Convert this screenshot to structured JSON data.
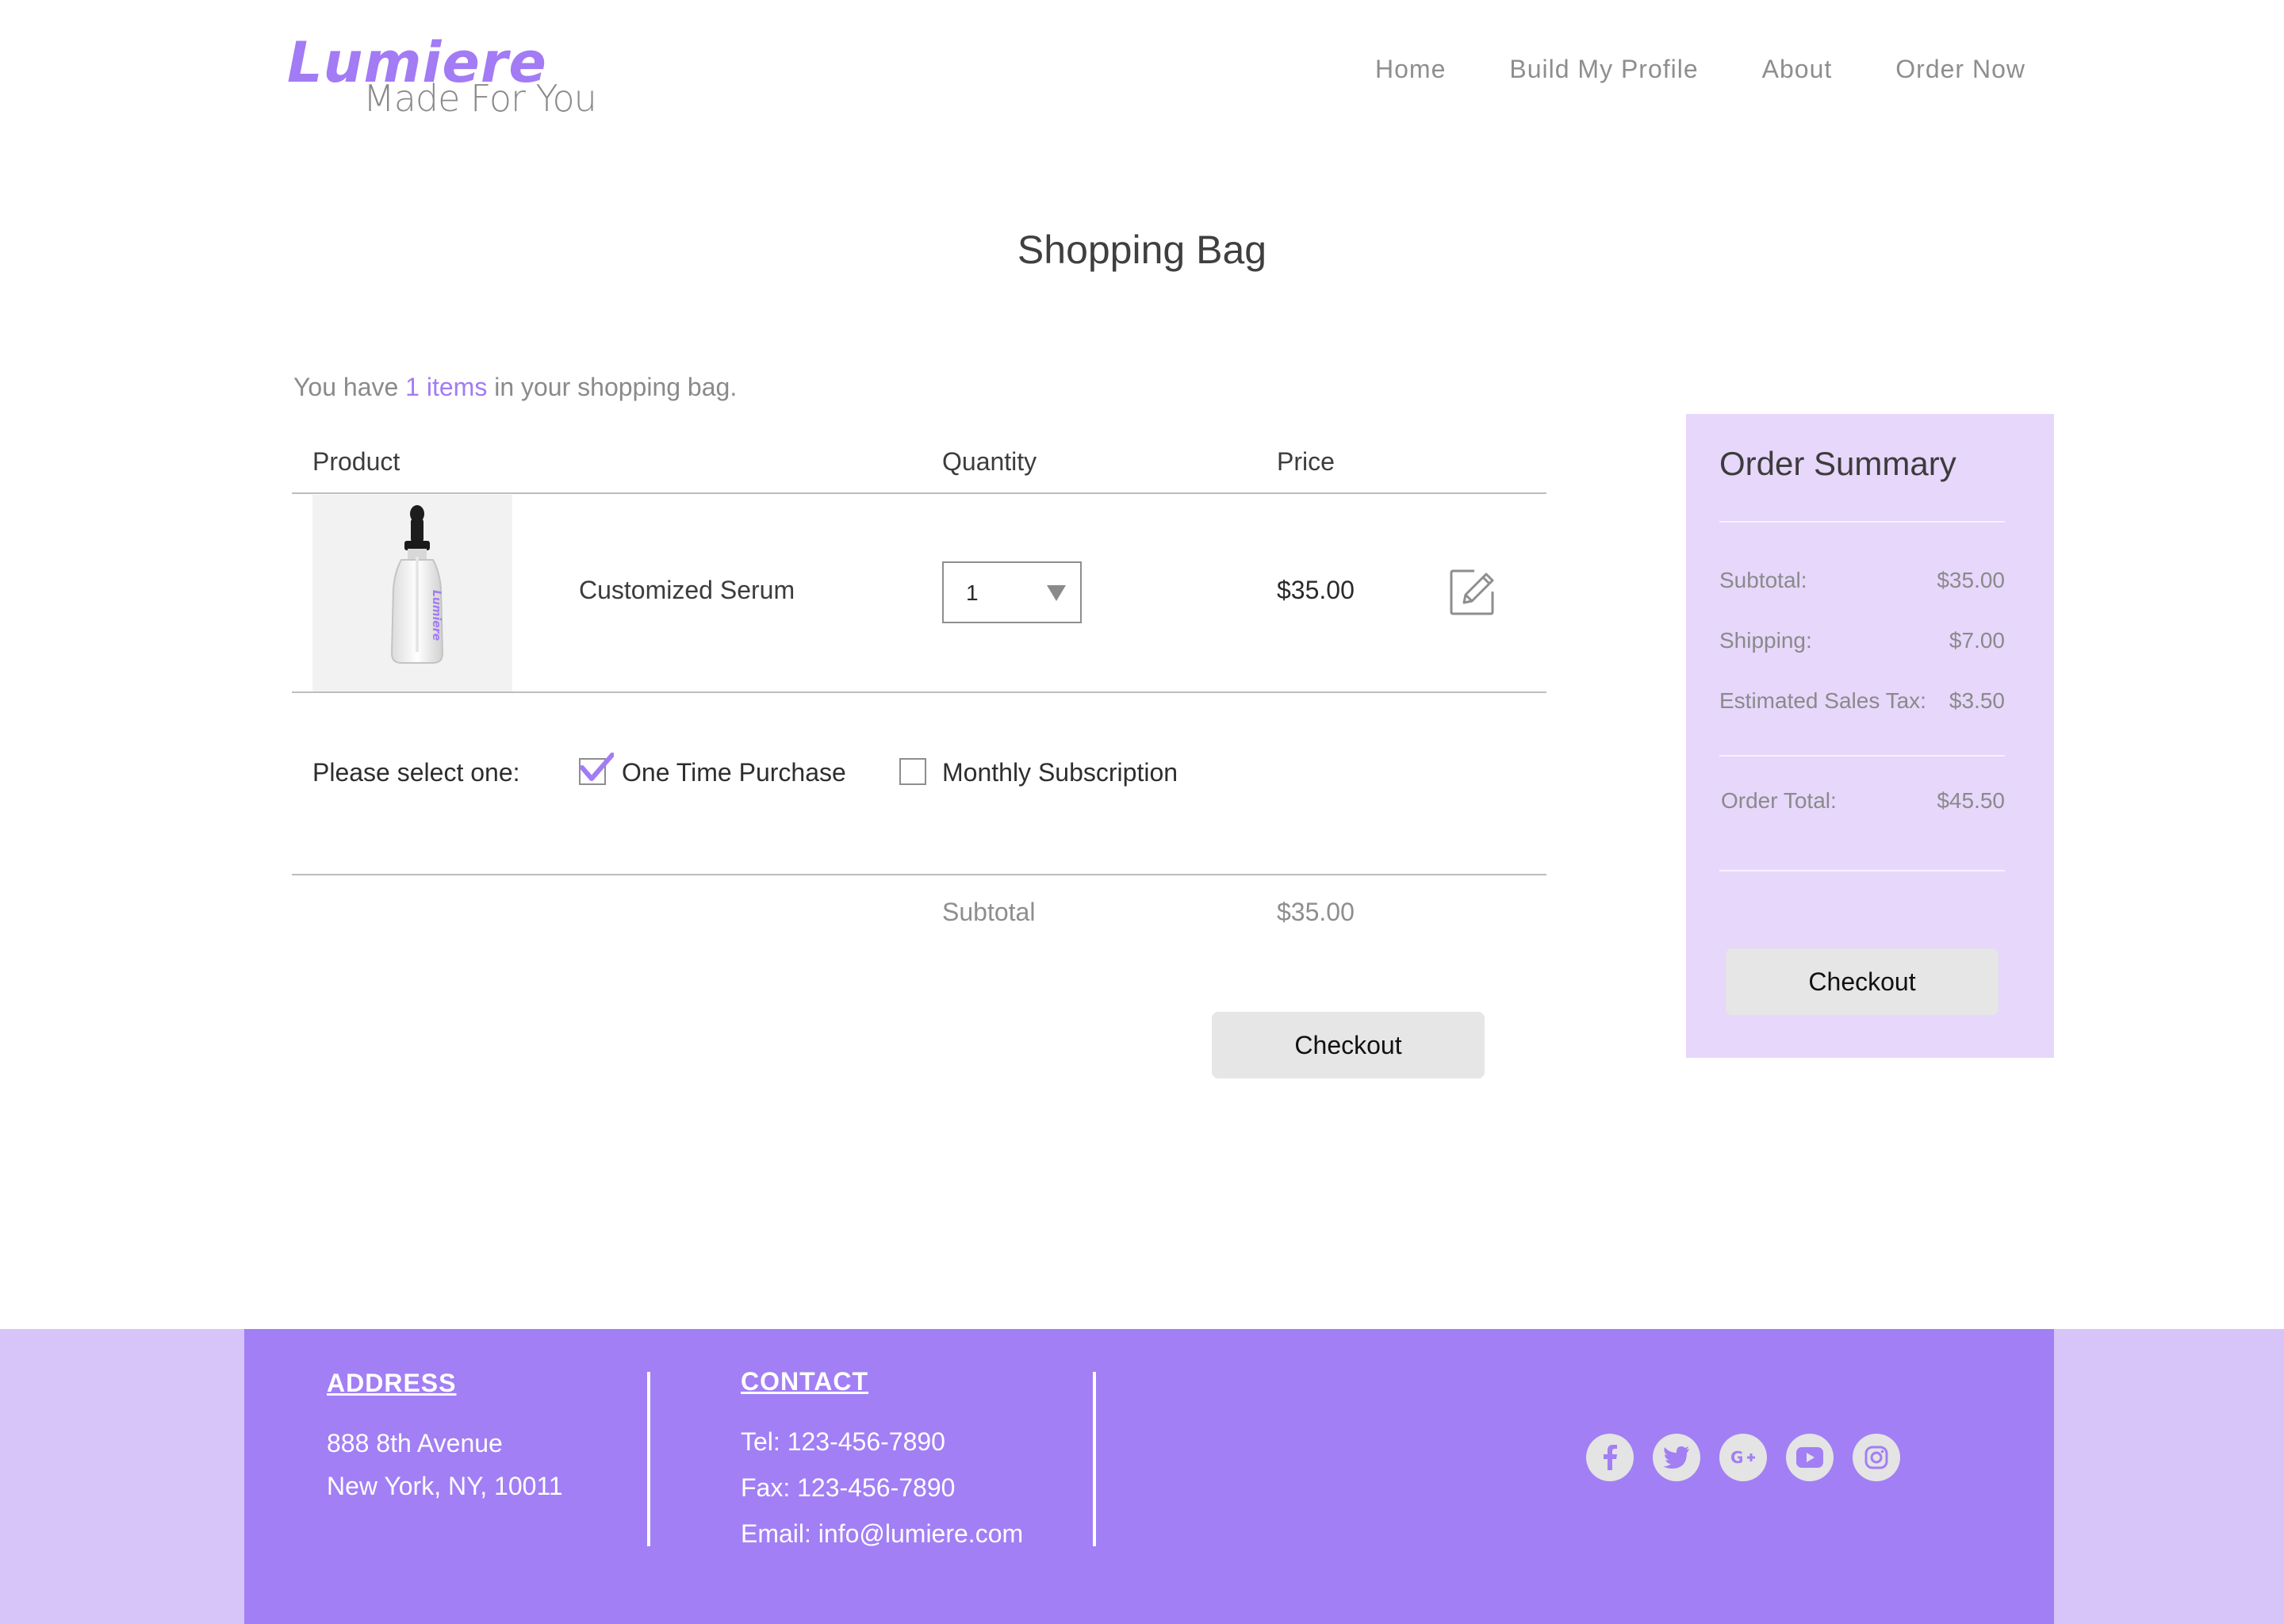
{
  "brand": {
    "name": "Lumiere",
    "tagline": "Made For You",
    "accent_color": "#a27bf5"
  },
  "nav": {
    "items": [
      {
        "label": "Home"
      },
      {
        "label": "Build My Profile"
      },
      {
        "label": "About"
      },
      {
        "label": "Order Now"
      }
    ]
  },
  "page": {
    "title": "Shopping Bag"
  },
  "bag": {
    "prefix": "You have",
    "count_text": "1 items",
    "suffix": "in your shopping bag."
  },
  "table": {
    "headers": {
      "product": "Product",
      "quantity": "Quantity",
      "price": "Price"
    },
    "rows": [
      {
        "product_name": "Customized Serum",
        "bottle_label": "Lumiere",
        "quantity": "1",
        "price": "$35.00",
        "edit_icon": "edit-pencil-icon"
      }
    ],
    "purchase_prompt": "Please select one:",
    "purchase_options": [
      {
        "label": "One Time Purchase",
        "checked": true
      },
      {
        "label": "Monthly Subscription",
        "checked": false
      }
    ],
    "subtotal_label": "Subtotal",
    "subtotal_value": "$35.00",
    "checkout_label": "Checkout"
  },
  "summary": {
    "title": "Order Summary",
    "subtotal_label": "Subtotal:",
    "subtotal_value": "$35.00",
    "shipping_label": "Shipping:",
    "shipping_value": "$7.00",
    "tax_label": "Estimated Sales Tax:",
    "tax_value": "$3.50",
    "total_label": "Order Total:",
    "total_value": "$45.50",
    "checkout_label": "Checkout",
    "background_color": "#e7d7fb"
  },
  "footer": {
    "address_heading": "ADDRESS",
    "address_line1": "888 8th Avenue",
    "address_line2": "New York, NY, 10011",
    "contact_heading": "CONTACT",
    "tel": "Tel: 123-456-7890",
    "fax": "Fax: 123-456-7890",
    "email": "Email: info@lumiere.com",
    "social_icons": [
      "facebook-icon",
      "twitter-icon",
      "google-plus-icon",
      "youtube-icon",
      "instagram-icon"
    ],
    "background_color": "#a27ff4"
  }
}
